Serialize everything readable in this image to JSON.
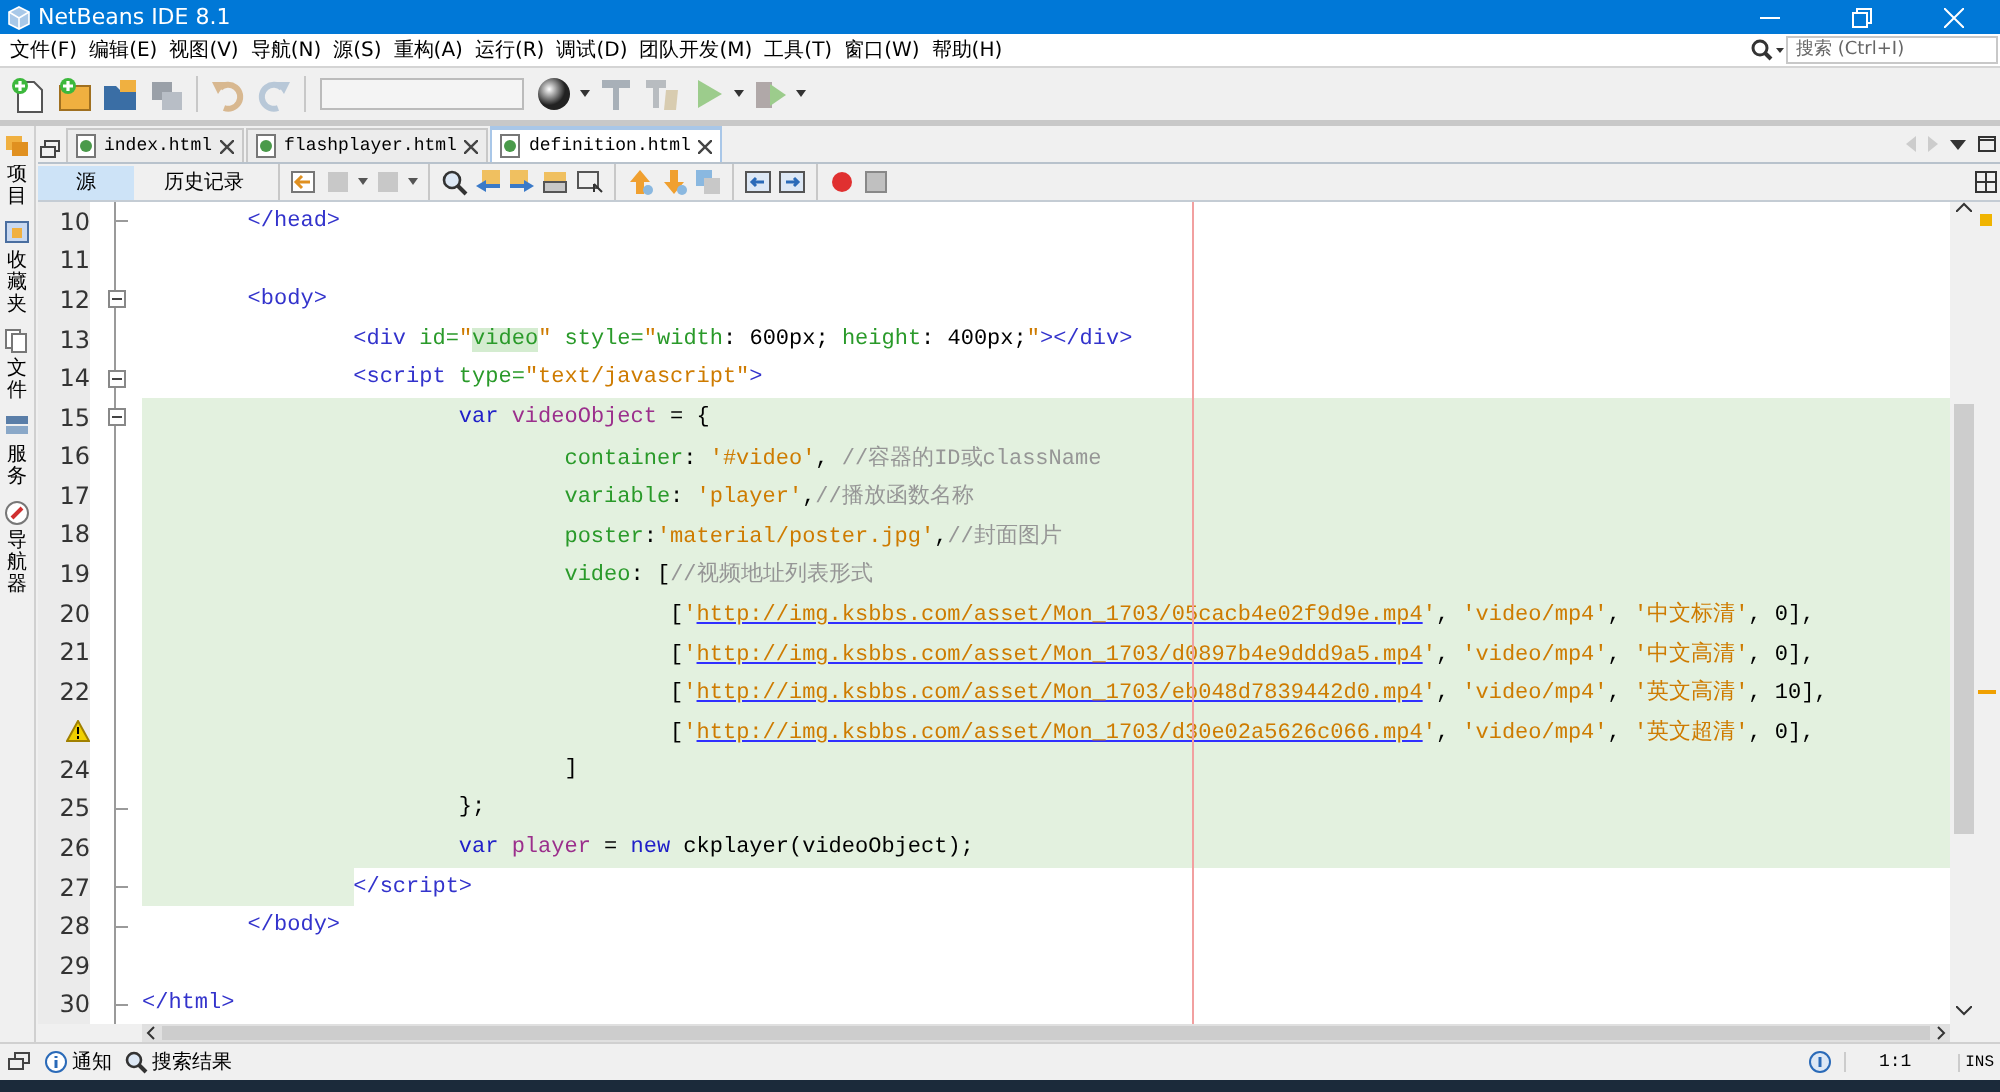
{
  "window": {
    "title": "NetBeans IDE 8.1"
  },
  "menu": [
    "文件(F)",
    "编辑(E)",
    "视图(V)",
    "导航(N)",
    "源(S)",
    "重构(A)",
    "运行(R)",
    "调试(D)",
    "团队开发(M)",
    "工具(T)",
    "窗口(W)",
    "帮助(H)"
  ],
  "search": {
    "placeholder": "搜索 (Ctrl+I)"
  },
  "side_tabs": [
    "项目",
    "收藏夹",
    "文件",
    "服务",
    "导航器"
  ],
  "editor_tabs": [
    {
      "label": "index.html",
      "selected": false
    },
    {
      "label": "flashplayer.html",
      "selected": false
    },
    {
      "label": "definition.html",
      "selected": true
    }
  ],
  "view_tabs": [
    {
      "label": "源",
      "selected": true
    },
    {
      "label": "历史记录",
      "selected": false
    }
  ],
  "code_lines": [
    {
      "number": "10",
      "warning": false,
      "collapsible": false,
      "fold_end": true,
      "highlighted": false,
      "indent_highlighted": false,
      "tokens": [
        {
          "kind": "tag",
          "text": "        </head>"
        }
      ]
    },
    {
      "number": "11",
      "warning": false,
      "collapsible": false,
      "fold_end": false,
      "highlighted": false,
      "indent_highlighted": false
    },
    {
      "number": "12",
      "warning": false,
      "collapsible": true,
      "fold_end": false,
      "highlighted": false,
      "indent_highlighted": false,
      "tokens": [
        {
          "kind": "tag",
          "text": "        <body>"
        }
      ]
    },
    {
      "number": "13",
      "warning": false,
      "collapsible": false,
      "fold_end": false,
      "highlighted": false,
      "indent_highlighted": false,
      "tokens": [
        {
          "kind": "tag",
          "text": "                <div"
        },
        {
          "kind": "attr",
          "text": " id="
        },
        {
          "kind": "string",
          "text": "\""
        },
        {
          "kind": "marked",
          "text": "video"
        },
        {
          "kind": "string",
          "text": "\""
        },
        {
          "kind": "attr",
          "text": " style="
        },
        {
          "kind": "string",
          "text": "\""
        },
        {
          "kind": "attr",
          "text": "width"
        },
        {
          "kind": "plain",
          "text": ": 600px; "
        },
        {
          "kind": "attr",
          "text": "height"
        },
        {
          "kind": "plain",
          "text": ": 400px;"
        },
        {
          "kind": "string",
          "text": "\""
        },
        {
          "kind": "tag",
          "text": "></div>"
        }
      ]
    },
    {
      "number": "14",
      "warning": false,
      "collapsible": true,
      "fold_end": false,
      "highlighted": false,
      "indent_highlighted": false,
      "tokens": [
        {
          "kind": "tag",
          "text": "                <script"
        },
        {
          "kind": "attr",
          "text": " type="
        },
        {
          "kind": "string",
          "text": "\"text/javascript\""
        },
        {
          "kind": "tag",
          "text": ">"
        }
      ]
    },
    {
      "number": "15",
      "warning": false,
      "collapsible": true,
      "fold_end": false,
      "highlighted": true,
      "indent_highlighted": false,
      "tokens": [
        {
          "kind": "keyword",
          "text": "                        var"
        },
        {
          "kind": "ident",
          "text": " videoObject"
        },
        {
          "kind": "plain",
          "text": " = {"
        }
      ]
    },
    {
      "number": "16",
      "warning": false,
      "collapsible": false,
      "fold_end": false,
      "highlighted": true,
      "indent_highlighted": false,
      "tokens": [
        {
          "kind": "prop",
          "text": "                                container"
        },
        {
          "kind": "plain",
          "text": ": "
        },
        {
          "kind": "string",
          "text": "'#video'"
        },
        {
          "kind": "plain",
          "text": ", "
        },
        {
          "kind": "comment",
          "text": "//容器的ID或className"
        }
      ]
    },
    {
      "number": "17",
      "warning": false,
      "collapsible": false,
      "fold_end": false,
      "highlighted": true,
      "indent_highlighted": false,
      "tokens": [
        {
          "kind": "prop",
          "text": "                                variable"
        },
        {
          "kind": "plain",
          "text": ": "
        },
        {
          "kind": "string",
          "text": "'player'"
        },
        {
          "kind": "plain",
          "text": ","
        },
        {
          "kind": "comment",
          "text": "//播放函数名称"
        }
      ]
    },
    {
      "number": "18",
      "warning": false,
      "collapsible": false,
      "fold_end": false,
      "highlighted": true,
      "indent_highlighted": false,
      "tokens": [
        {
          "kind": "prop",
          "text": "                                poster"
        },
        {
          "kind": "plain",
          "text": ":"
        },
        {
          "kind": "string",
          "text": "'material/poster.jpg'"
        },
        {
          "kind": "plain",
          "text": ","
        },
        {
          "kind": "comment",
          "text": "//封面图片"
        }
      ]
    },
    {
      "number": "19",
      "warning": false,
      "collapsible": false,
      "fold_end": false,
      "highlighted": true,
      "indent_highlighted": false,
      "tokens": [
        {
          "kind": "prop",
          "text": "                                video"
        },
        {
          "kind": "plain",
          "text": ": ["
        },
        {
          "kind": "comment",
          "text": "//视频地址列表形式"
        }
      ]
    },
    {
      "number": "20",
      "warning": false,
      "collapsible": false,
      "fold_end": false,
      "highlighted": true,
      "indent_highlighted": false,
      "tokens": [
        {
          "kind": "plain",
          "text": "                                        ["
        },
        {
          "kind": "string",
          "text": "'"
        },
        {
          "kind": "link",
          "text": "http://img.ksbbs.com/asset/Mon_1703/05cacb4e02f9d9e.mp4"
        },
        {
          "kind": "string",
          "text": "'"
        },
        {
          "kind": "plain",
          "text": ", "
        },
        {
          "kind": "string",
          "text": "'video/mp4'"
        },
        {
          "kind": "plain",
          "text": ", "
        },
        {
          "kind": "string",
          "text": "'中文标清'"
        },
        {
          "kind": "plain",
          "text": ", 0],"
        }
      ]
    },
    {
      "number": "21",
      "warning": false,
      "collapsible": false,
      "fold_end": false,
      "highlighted": true,
      "indent_highlighted": false,
      "tokens": [
        {
          "kind": "plain",
          "text": "                                        ["
        },
        {
          "kind": "string",
          "text": "'"
        },
        {
          "kind": "link",
          "text": "http://img.ksbbs.com/asset/Mon_1703/d0897b4e9ddd9a5.mp4"
        },
        {
          "kind": "string",
          "text": "'"
        },
        {
          "kind": "plain",
          "text": ", "
        },
        {
          "kind": "string",
          "text": "'video/mp4'"
        },
        {
          "kind": "plain",
          "text": ", "
        },
        {
          "kind": "string",
          "text": "'中文高清'"
        },
        {
          "kind": "plain",
          "text": ", 0],"
        }
      ]
    },
    {
      "number": "22",
      "warning": false,
      "collapsible": false,
      "fold_end": false,
      "highlighted": true,
      "indent_highlighted": false,
      "tokens": [
        {
          "kind": "plain",
          "text": "                                        ["
        },
        {
          "kind": "string",
          "text": "'"
        },
        {
          "kind": "link",
          "text": "http://img.ksbbs.com/asset/Mon_1703/eb048d7839442d0.mp4"
        },
        {
          "kind": "string",
          "text": "'"
        },
        {
          "kind": "plain",
          "text": ", "
        },
        {
          "kind": "string",
          "text": "'video/mp4'"
        },
        {
          "kind": "plain",
          "text": ", "
        },
        {
          "kind": "string",
          "text": "'英文高清'"
        },
        {
          "kind": "plain",
          "text": ", 10],"
        }
      ]
    },
    {
      "warning": true,
      "collapsible": false,
      "fold_end": false,
      "highlighted": true,
      "indent_highlighted": false,
      "tokens": [
        {
          "kind": "plain",
          "text": "                                        ["
        },
        {
          "kind": "string",
          "text": "'"
        },
        {
          "kind": "link",
          "text": "http://img.ksbbs.com/asset/Mon_1703/d30e02a5626c066.mp4"
        },
        {
          "kind": "string",
          "text": "'"
        },
        {
          "kind": "plain",
          "text": ", "
        },
        {
          "kind": "string",
          "text": "'video/mp4'"
        },
        {
          "kind": "plain",
          "text": ", "
        },
        {
          "kind": "string",
          "text": "'英文超清'"
        },
        {
          "kind": "plain",
          "text": ", 0],"
        }
      ]
    },
    {
      "number": "24",
      "warning": false,
      "collapsible": false,
      "fold_end": false,
      "highlighted": true,
      "indent_highlighted": false,
      "tokens": [
        {
          "kind": "plain",
          "text": "                                ]"
        }
      ]
    },
    {
      "number": "25",
      "warning": false,
      "collapsible": false,
      "fold_end": true,
      "highlighted": true,
      "indent_highlighted": false,
      "tokens": [
        {
          "kind": "plain",
          "text": "                        };"
        }
      ]
    },
    {
      "number": "26",
      "warning": false,
      "collapsible": false,
      "fold_end": false,
      "highlighted": true,
      "indent_highlighted": false,
      "tokens": [
        {
          "kind": "keyword",
          "text": "                        var"
        },
        {
          "kind": "ident",
          "text": " player"
        },
        {
          "kind": "plain",
          "text": " = "
        },
        {
          "kind": "keyword",
          "text": "new"
        },
        {
          "kind": "plain",
          "text": " ckplayer(videoObject);"
        }
      ]
    },
    {
      "number": "27",
      "warning": false,
      "collapsible": false,
      "fold_end": true,
      "highlighted": false,
      "indent_highlighted": true,
      "tokens": [
        {
          "kind": "tag",
          "text": "                </script>"
        }
      ]
    },
    {
      "number": "28",
      "warning": false,
      "collapsible": false,
      "fold_end": true,
      "highlighted": false,
      "indent_highlighted": false,
      "tokens": [
        {
          "kind": "tag",
          "text": "        </body>"
        }
      ]
    },
    {
      "number": "29",
      "warning": false,
      "collapsible": false,
      "fold_end": false,
      "highlighted": false,
      "indent_highlighted": false
    },
    {
      "number": "30",
      "warning": false,
      "collapsible": false,
      "fold_end": true,
      "highlighted": false,
      "indent_highlighted": false,
      "tokens": [
        {
          "kind": "tag",
          "text": "</html>"
        }
      ]
    }
  ],
  "status_bar": {
    "items": [
      "通知",
      "搜索结果"
    ],
    "position": "1:1",
    "mode": "INS"
  }
}
